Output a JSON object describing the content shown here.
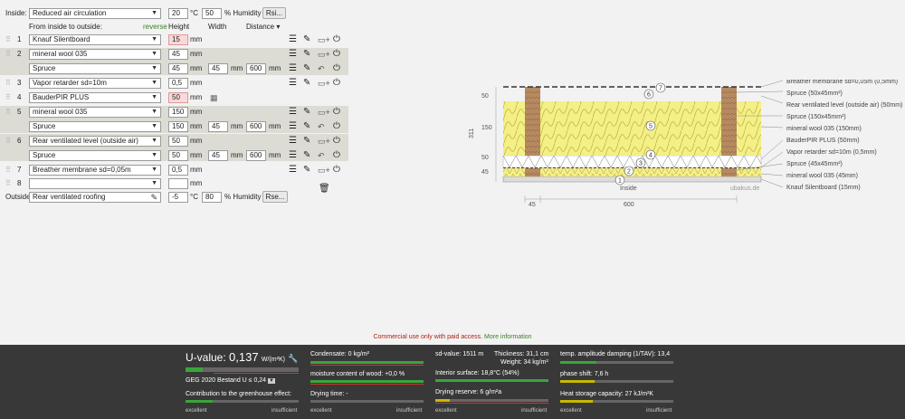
{
  "inside": {
    "label": "Inside:",
    "select": "Reduced air circulation",
    "temp": "20",
    "temp_unit": "°C",
    "humidity": "50",
    "humidity_unit": "% Humidity",
    "button": "Rsi..."
  },
  "header": {
    "from_label": "From inside to outside:",
    "reverse": "reverse",
    "height": "Height",
    "width": "Width",
    "distance": "Distance",
    "distance_arrow": "▾"
  },
  "unit_mm": "mm",
  "layers": [
    {
      "num": "1",
      "material": "Knauf Silentboard",
      "height": "15",
      "pink": true
    },
    {
      "num": "2",
      "material": "mineral wool 035",
      "height": "45",
      "sub": {
        "material": "Spruce",
        "height": "45",
        "width": "45",
        "distance": "600"
      }
    },
    {
      "num": "3",
      "material": "Vapor retarder sd=10m",
      "height": "0,5"
    },
    {
      "num": "4",
      "material": "BauderPIR PLUS",
      "height": "50",
      "pink": true
    },
    {
      "num": "5",
      "material": "mineral wool 035",
      "height": "150",
      "sub": {
        "material": "Spruce",
        "height": "150",
        "width": "45",
        "distance": "600"
      }
    },
    {
      "num": "6",
      "material": "Rear ventilated level (outside air)",
      "height": "50",
      "sub": {
        "material": "Spruce",
        "height": "50",
        "width": "45",
        "distance": "600"
      }
    },
    {
      "num": "7",
      "material": "Breather membrane sd=0,05m",
      "height": "0,5"
    },
    {
      "num": "8",
      "material": "",
      "height": ""
    }
  ],
  "outside": {
    "label": "Outside",
    "select": "Rear ventilated roofing",
    "temp": "-5",
    "temp_unit": "°C",
    "humidity": "80",
    "humidity_unit": "% Humidity",
    "button": "Rse..."
  },
  "diagram": {
    "dims_left": [
      "50",
      "150",
      "50",
      "45"
    ],
    "total": "311",
    "bottom_dims": [
      "45",
      "600"
    ],
    "inside_label": "Inside",
    "watermark": "ubakus.de",
    "circles": [
      "7",
      "6",
      "5",
      "4",
      "3",
      "2",
      "1"
    ],
    "legend": [
      "Breather membrane sd=0,05m (0,5mm)",
      "Spruce (50x45mm²)",
      "Rear ventilated level (outside air) (50mm)",
      "Spruce (150x45mm²)",
      "mineral wool 035 (150mm)",
      "BauderPIR PLUS (50mm)",
      "Vapor retarder sd=10m (0,5mm)",
      "Spruce (45x45mm²)",
      "mineral wool 035 (45mm)",
      "Knauf Silentboard (15mm)"
    ]
  },
  "notice": {
    "text": "Commercial use only with paid access. ",
    "link": "More information"
  },
  "footer": {
    "uvalue_label": "U-value:",
    "uvalue": "0,137",
    "uvalue_unit": "W/(m²K)",
    "uvalue_fill": 0.15,
    "geg": "GEG 2020 Bestand U ≤ 0,24",
    "contribution": "Contribution to the greenhouse effect:",
    "condensate": "Condensate: 0 kg/m²",
    "moisture": "moisture content of wood: +0,0 %",
    "drying_time": "Drying time: -",
    "sd_value": "sd-value: 1511 m",
    "thickness": "Thickness: 31,1 cm",
    "weight": "Weight: 34 kg/m²",
    "interior_surface": "Interior surface: 18,8°C (54%)",
    "drying_reserve": "Drying reserve: 6 g/m²a",
    "temp_damping": "temp. amplitude damping (1/TAV): 13,4",
    "phase_shift": "phase shift: 7,6 h",
    "heat_storage": "Heat storage capacity: 27 kJ/m²K",
    "excellent": "excellent",
    "insufficient": "insufficient",
    "colors": {
      "good": "#3aa53a",
      "mid": "#c8b800",
      "bad": "#c33333"
    }
  }
}
